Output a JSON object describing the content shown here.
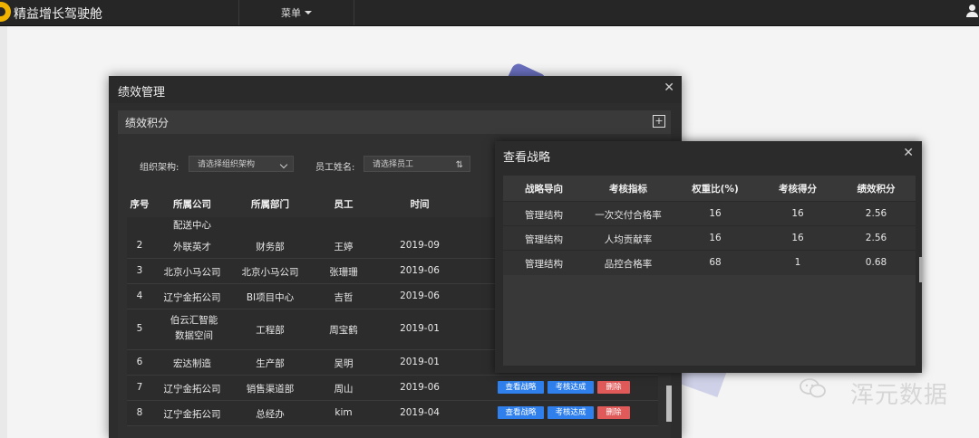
{
  "app": {
    "title": "精益增长驾驶舱",
    "menu_label": "菜单"
  },
  "dialog": {
    "title": "绩效管理",
    "panel_title": "绩效积分",
    "filters": {
      "org_label": "组织架构:",
      "org_placeholder": "请选择组织架构",
      "employee_label": "员工姓名:",
      "employee_placeholder": "请选择员工"
    },
    "table": {
      "headers": [
        "序号",
        "所属公司",
        "所属部门",
        "员工",
        "时间"
      ],
      "partial_row": {
        "company": "配送中心"
      },
      "rows": [
        {
          "no": "2",
          "company": "外联英才",
          "dept": "财务部",
          "employee": "王婷",
          "time": "2019-09"
        },
        {
          "no": "3",
          "company": "北京小马公司",
          "dept": "北京小马公司",
          "employee": "张珊珊",
          "time": "2019-06"
        },
        {
          "no": "4",
          "company": "辽宁金拓公司",
          "dept": "BI项目中心",
          "employee": "吉哲",
          "time": "2019-06"
        },
        {
          "no": "5",
          "company": "伯云汇智能数据空间",
          "dept": "工程部",
          "employee": "周宝鹤",
          "time": "2019-01"
        },
        {
          "no": "6",
          "company": "宏达制造",
          "dept": "生产部",
          "employee": "吴明",
          "time": "2019-01"
        },
        {
          "no": "7",
          "company": "辽宁金拓公司",
          "dept": "销售渠道部",
          "employee": "周山",
          "time": "2019-06"
        },
        {
          "no": "8",
          "company": "辽宁金拓公司",
          "dept": "总经办",
          "employee": "kim",
          "time": "2019-04"
        }
      ],
      "actions": {
        "view": "查看战略",
        "assess": "考核达成",
        "delete": "删除"
      }
    }
  },
  "popup": {
    "title": "查看战略",
    "headers": [
      "战略导向",
      "考核指标",
      "权重比(%)",
      "考核得分",
      "绩效积分"
    ],
    "rows": [
      [
        "管理结构",
        "一次交付合格率",
        "16",
        "16",
        "2.56"
      ],
      [
        "管理结构",
        "人均贡献率",
        "16",
        "16",
        "2.56"
      ],
      [
        "管理结构",
        "品控合格率",
        "68",
        "1",
        "0.68"
      ]
    ]
  },
  "watermark": {
    "text": "浑元数据"
  },
  "colors": {
    "primary_button": "#2f80ed",
    "danger_button": "#e05a5a",
    "dialog_bg": "#2d2d2d"
  }
}
